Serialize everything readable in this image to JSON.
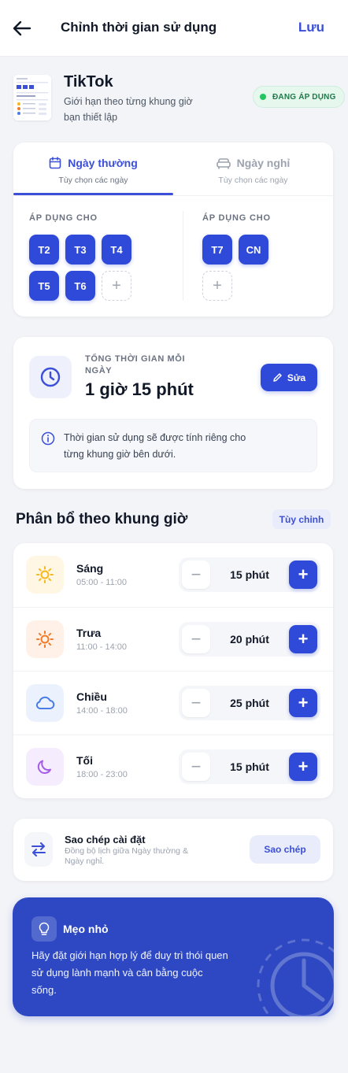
{
  "header": {
    "title": "Chỉnh thời gian sử dụng",
    "save_label": "Lưu"
  },
  "app": {
    "name": "TikTok",
    "description": "Giới hạn theo từng khung giờ bạn thiết lập",
    "status_badge": "ĐANG ÁP DỤNG"
  },
  "tabs": [
    {
      "label": "Ngày thường",
      "sub": "Tùy chọn các ngày"
    },
    {
      "label": "Ngày nghỉ",
      "sub": "Tùy chọn các ngày"
    }
  ],
  "weekday": {
    "apply_label": "ÁP DỤNG CHO",
    "chips": [
      "T2",
      "T3",
      "T4",
      "T5",
      "T6"
    ],
    "add": "+"
  },
  "weekend": {
    "apply_label": "ÁP DỤNG CHO",
    "chips": [
      "T7",
      "CN"
    ],
    "add": "+"
  },
  "total": {
    "label": "TỔNG THỜI GIAN MỖI NGÀY",
    "value": "1 giờ 15 phút",
    "edit_label": "Sửa",
    "note": "Thời gian sử dụng sẽ được tính riêng cho từng khung giờ bên dưới."
  },
  "allocation": {
    "title": "Phân bổ theo khung giờ",
    "custom_label": "Tùy chỉnh",
    "slots": [
      {
        "name": "Sáng",
        "time": "05:00 - 11:00",
        "value": "15 phút",
        "icon": "sun-icon",
        "color": "#f5b91e",
        "bg": "#fff6e3"
      },
      {
        "name": "Trưa",
        "time": "11:00 - 14:00",
        "value": "20 phút",
        "icon": "sun-hot-icon",
        "color": "#f07c2a",
        "bg": "#fff1e8"
      },
      {
        "name": "Chiều",
        "time": "14:00 - 18:00",
        "value": "25 phút",
        "icon": "cloud-icon",
        "color": "#4a7be6",
        "bg": "#ecf2fd"
      },
      {
        "name": "Tối",
        "time": "18:00 - 23:00",
        "value": "15 phút",
        "icon": "moon-icon",
        "color": "#a55be8",
        "bg": "#f5ecfd"
      }
    ],
    "minus": "−",
    "plus": "+"
  },
  "copy": {
    "title": "Sao chép cài đặt",
    "subtitle": "Đồng bộ lịch giữa Ngày thường & Ngày nghỉ.",
    "button": "Sao chép"
  },
  "tip": {
    "title": "Mẹo nhỏ",
    "text": "Hãy đặt giới hạn hợp lý để duy trì thói quen sử dụng lành mạnh và cân bằng cuộc sống."
  },
  "colors": {
    "primary": "#2f49d8",
    "accent_text": "#3b4fd8",
    "tip_bg": "#2d48c2",
    "success": "#22c55e"
  }
}
